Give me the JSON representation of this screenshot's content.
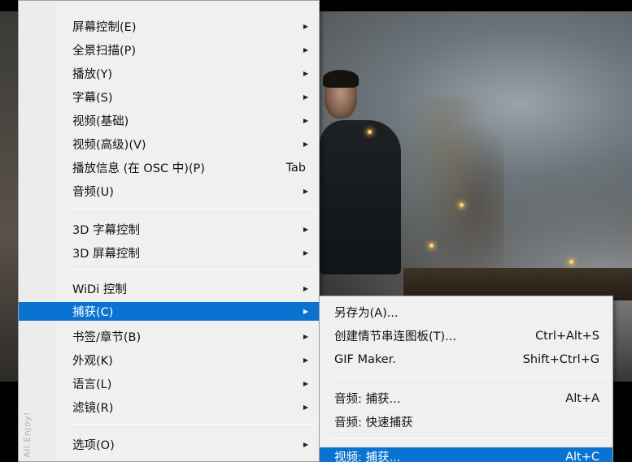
{
  "main_menu": {
    "side_text": "All Enjoy!",
    "items": [
      {
        "label": "屏幕控制(E)",
        "arrow": "▶"
      },
      {
        "label": "全景扫描(P)",
        "arrow": "▶"
      },
      {
        "label": "播放(Y)",
        "arrow": "▶"
      },
      {
        "label": "字幕(S)",
        "arrow": "▶"
      },
      {
        "label": "视频(基础)",
        "arrow": "▶"
      },
      {
        "label": "视频(高级)(V)",
        "arrow": "▶"
      },
      {
        "label": "播放信息 (在 OSC 中)(P)",
        "shortcut": "Tab"
      },
      {
        "label": "音频(U)",
        "arrow": "▶"
      },
      {
        "label": "3D 字幕控制",
        "arrow": "▶"
      },
      {
        "label": "3D 屏幕控制",
        "arrow": "▶"
      },
      {
        "label": "WiDi 控制",
        "arrow": "▶"
      },
      {
        "label": "捕获(C)",
        "arrow": "▶"
      },
      {
        "label": "书签/章节(B)",
        "arrow": "▶"
      },
      {
        "label": "外观(K)",
        "arrow": "▶"
      },
      {
        "label": "语言(L)",
        "arrow": "▶"
      },
      {
        "label": "滤镜(R)",
        "arrow": "▶"
      },
      {
        "label": "选项(O)",
        "arrow": "▶"
      }
    ]
  },
  "capture_submenu": {
    "items": [
      {
        "label": "另存为(A)..."
      },
      {
        "label": "创建情节串连图板(T)...",
        "shortcut": "Ctrl+Alt+S"
      },
      {
        "label": "GIF Maker.",
        "shortcut": "Shift+Ctrl+G"
      },
      {
        "label": "音频: 捕获...",
        "shortcut": "Alt+A"
      },
      {
        "label": "音频: 快速捕获"
      },
      {
        "label": "视频: 捕获...",
        "shortcut": "Alt+C"
      }
    ]
  },
  "colors": {
    "menu_bg": "#f0f0f0",
    "highlight": "#0a73d1"
  }
}
